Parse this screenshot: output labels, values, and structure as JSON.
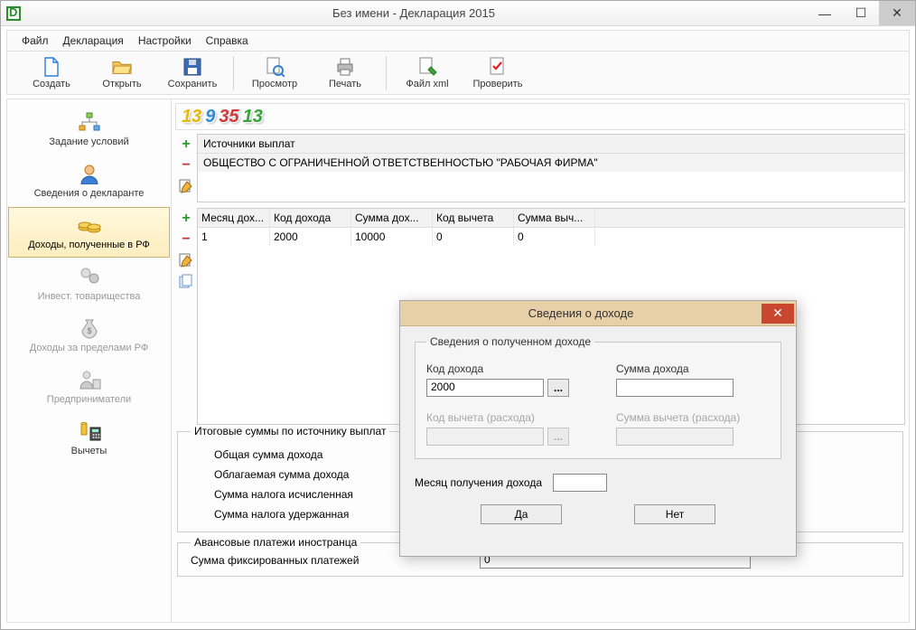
{
  "window": {
    "title": "Без имени - Декларация 2015"
  },
  "menu": {
    "file": "Файл",
    "declaration": "Декларация",
    "settings": "Настройки",
    "help": "Справка"
  },
  "toolbar": {
    "new": "Создать",
    "open": "Открыть",
    "save": "Сохранить",
    "preview": "Просмотр",
    "print": "Печать",
    "xml": "Файл xml",
    "check": "Проверить"
  },
  "sidebar": {
    "items": [
      {
        "label": "Задание условий"
      },
      {
        "label": "Сведения о декларанте"
      },
      {
        "label": "Доходы, полученные в РФ"
      },
      {
        "label": "Инвест. товарищества"
      },
      {
        "label": "Доходы за пределами РФ"
      },
      {
        "label": "Предприниматели"
      },
      {
        "label": "Вычеты"
      }
    ]
  },
  "tabs": {
    "n1": "13",
    "n2": "9",
    "n3": "35",
    "n4": "13"
  },
  "sources": {
    "header": "  Источники выплат",
    "row0": "ОБЩЕСТВО С ОГРАНИЧЕННОЙ ОТВЕТСТВЕННОСТЬЮ \"РАБОЧАЯ ФИРМА\""
  },
  "income_table": {
    "headers": {
      "c1": "Месяц дох...",
      "c2": "Код дохода",
      "c3": "Сумма дох...",
      "c4": "Код вычета",
      "c5": "Сумма выч..."
    },
    "rows": [
      {
        "c1": "1",
        "c2": "2000",
        "c3": "10000",
        "c4": "0",
        "c5": "0"
      }
    ]
  },
  "totals": {
    "legend": "Итоговые суммы по источнику выплат",
    "r1": "Общая сумма дохода",
    "r2": "Облагаемая сумма дохода",
    "r3": "Сумма налога исчисленная",
    "r4": "Сумма налога удержанная"
  },
  "advance": {
    "legend": "Авансовые платежи иностранца",
    "label": "Сумма фиксированных платежей",
    "value": "0"
  },
  "dialog": {
    "title": "Сведения о доходе",
    "group_legend": "Сведения о полученном доходе",
    "code_label": "Код дохода",
    "code_value": "2000",
    "sum_label": "Сумма дохода",
    "sum_value": "",
    "deduct_code_label": "Код вычета (расхода)",
    "deduct_sum_label": "Сумма вычета (расхода)",
    "month_label": "Месяц получения дохода",
    "month_value": "",
    "yes": "Да",
    "no": "Нет"
  }
}
